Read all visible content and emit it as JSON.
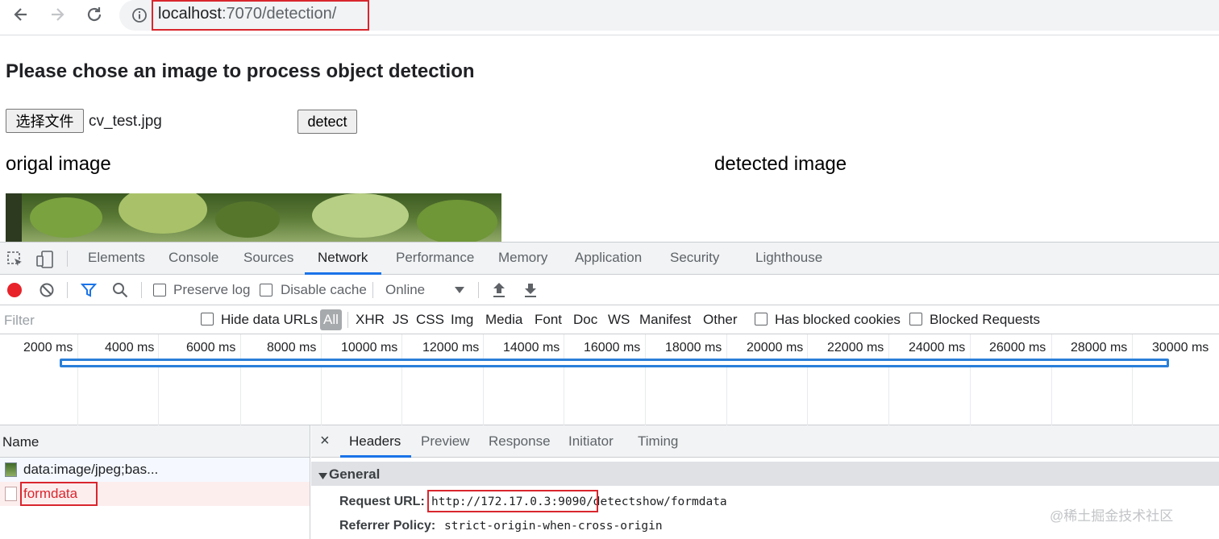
{
  "browser": {
    "url_host": "localhost",
    "url_rest": ":7070/detection/",
    "back_icon": "arrow-left-icon",
    "forward_icon": "arrow-right-icon",
    "reload_icon": "reload-icon",
    "info_icon": "info-icon"
  },
  "page": {
    "heading": "Please chose an image to process object detection",
    "choose_file_label": "选择文件",
    "file_name": "cv_test.jpg",
    "detect_label": "detect",
    "original_caption": "origal image",
    "detected_caption": "detected image"
  },
  "devtools": {
    "tabs": [
      "Elements",
      "Console",
      "Sources",
      "Network",
      "Performance",
      "Memory",
      "Application",
      "Security",
      "Lighthouse"
    ],
    "active_tab": "Network",
    "toolbar": {
      "preserve_log": "Preserve log",
      "disable_cache": "Disable cache",
      "throttle": "Online"
    },
    "filter": {
      "placeholder": "Filter",
      "hide_data_urls": "Hide data URLs",
      "types": [
        "All",
        "XHR",
        "JS",
        "CSS",
        "Img",
        "Media",
        "Font",
        "Doc",
        "WS",
        "Manifest",
        "Other"
      ],
      "active_type": "All",
      "has_blocked_cookies": "Has blocked cookies",
      "blocked_requests": "Blocked Requests"
    },
    "overview_ticks": [
      "2000 ms",
      "4000 ms",
      "6000 ms",
      "8000 ms",
      "10000 ms",
      "12000 ms",
      "14000 ms",
      "16000 ms",
      "18000 ms",
      "20000 ms",
      "22000 ms",
      "24000 ms",
      "26000 ms",
      "28000 ms",
      "30000 ms"
    ],
    "requests": {
      "header": "Name",
      "rows": [
        "data:image/jpeg;bas...",
        "formdata"
      ]
    },
    "details": {
      "close": "×",
      "tabs": [
        "Headers",
        "Preview",
        "Response",
        "Initiator",
        "Timing"
      ],
      "active_tab": "Headers",
      "section": "General",
      "request_url_label": "Request URL:",
      "request_url_host": "http://172.17.0.3:9090",
      "request_url_path": "/detectshow/formdata",
      "referrer_label": "Referrer Policy:",
      "referrer_value": "strict-origin-when-cross-origin"
    }
  },
  "watermark": "@稀土掘金技术社区",
  "colors": {
    "highlight_red": "#d9262e",
    "accent_blue": "#1a73e8",
    "record_red": "#e8232a"
  }
}
